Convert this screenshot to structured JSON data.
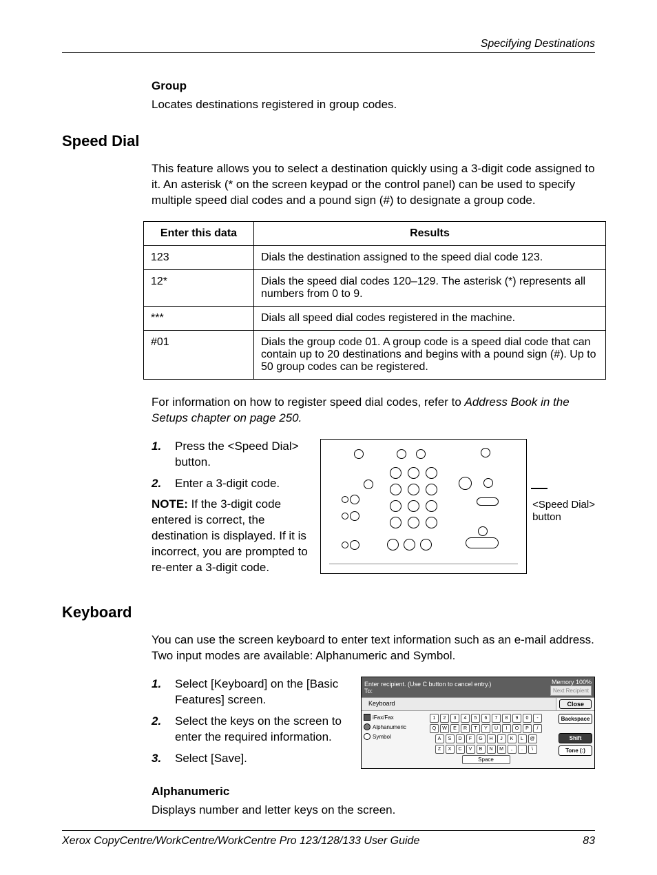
{
  "header": {
    "section": "Specifying Destinations"
  },
  "group": {
    "heading": "Group",
    "text": "Locates destinations registered in group codes."
  },
  "speed_dial": {
    "heading": "Speed Dial",
    "intro": "This feature allows you to select a destination quickly using a 3-digit code assigned to it. An asterisk (* on the screen keypad or the control panel) can be used to specify multiple speed dial codes and a pound sign (#) to designate a group code.",
    "table": {
      "col1_header": "Enter this data",
      "col2_header": "Results",
      "rows": [
        {
          "data": "123",
          "result": "Dials the destination assigned to the speed dial code 123."
        },
        {
          "data": "12*",
          "result": "Dials the speed dial codes 120–129. The asterisk (*) represents all numbers from 0 to 9."
        },
        {
          "data": "***",
          "result": "Dials all speed dial codes registered in the machine."
        },
        {
          "data": "#01",
          "result": "Dials the group code 01. A group code is a speed dial code that can contain up to 20 destinations and begins with a pound sign (#). Up to 50 group codes can be registered."
        }
      ]
    },
    "ref_prefix": "For information on how to register speed dial codes, refer to ",
    "ref_italic": "Address Book in the Setups chapter on page 250.",
    "steps": [
      "Press the <Speed Dial> button.",
      "Enter a 3-digit code."
    ],
    "note_label": "NOTE:",
    "note_text": " If the 3-digit code entered is correct, the destination is displayed. If it is incorrect, you are prompted to re-enter a 3-digit code.",
    "callout": "<Speed Dial>\nbutton"
  },
  "keyboard": {
    "heading": "Keyboard",
    "intro": "You can use the screen keyboard to enter text information such as an e-mail address. Two input modes are available: Alphanumeric and Symbol.",
    "steps": [
      "Select [Keyboard] on the [Basic Features] screen.",
      "Select the keys on the screen to enter the required information.",
      "Select [Save]."
    ],
    "alpha_heading": "Alphanumeric",
    "alpha_text": "Displays number and letter keys on the screen.",
    "ui": {
      "prompt": "Enter recipient. (Use C button to cancel entry.)",
      "to": "To:",
      "memory": "Memory 100%",
      "next": "Next Recipient",
      "tab": "Keyboard",
      "close": "Close",
      "mode1": "iFax/Fax",
      "mode2": "Alphanumeric",
      "mode3": "Symbol",
      "backspace": "Backspace",
      "shift": "Shift",
      "tone": "Tone (:)",
      "space": "Space"
    }
  },
  "footer": {
    "left": "Xerox CopyCentre/WorkCentre/WorkCentre Pro 123/128/133 User Guide",
    "right": "83"
  }
}
